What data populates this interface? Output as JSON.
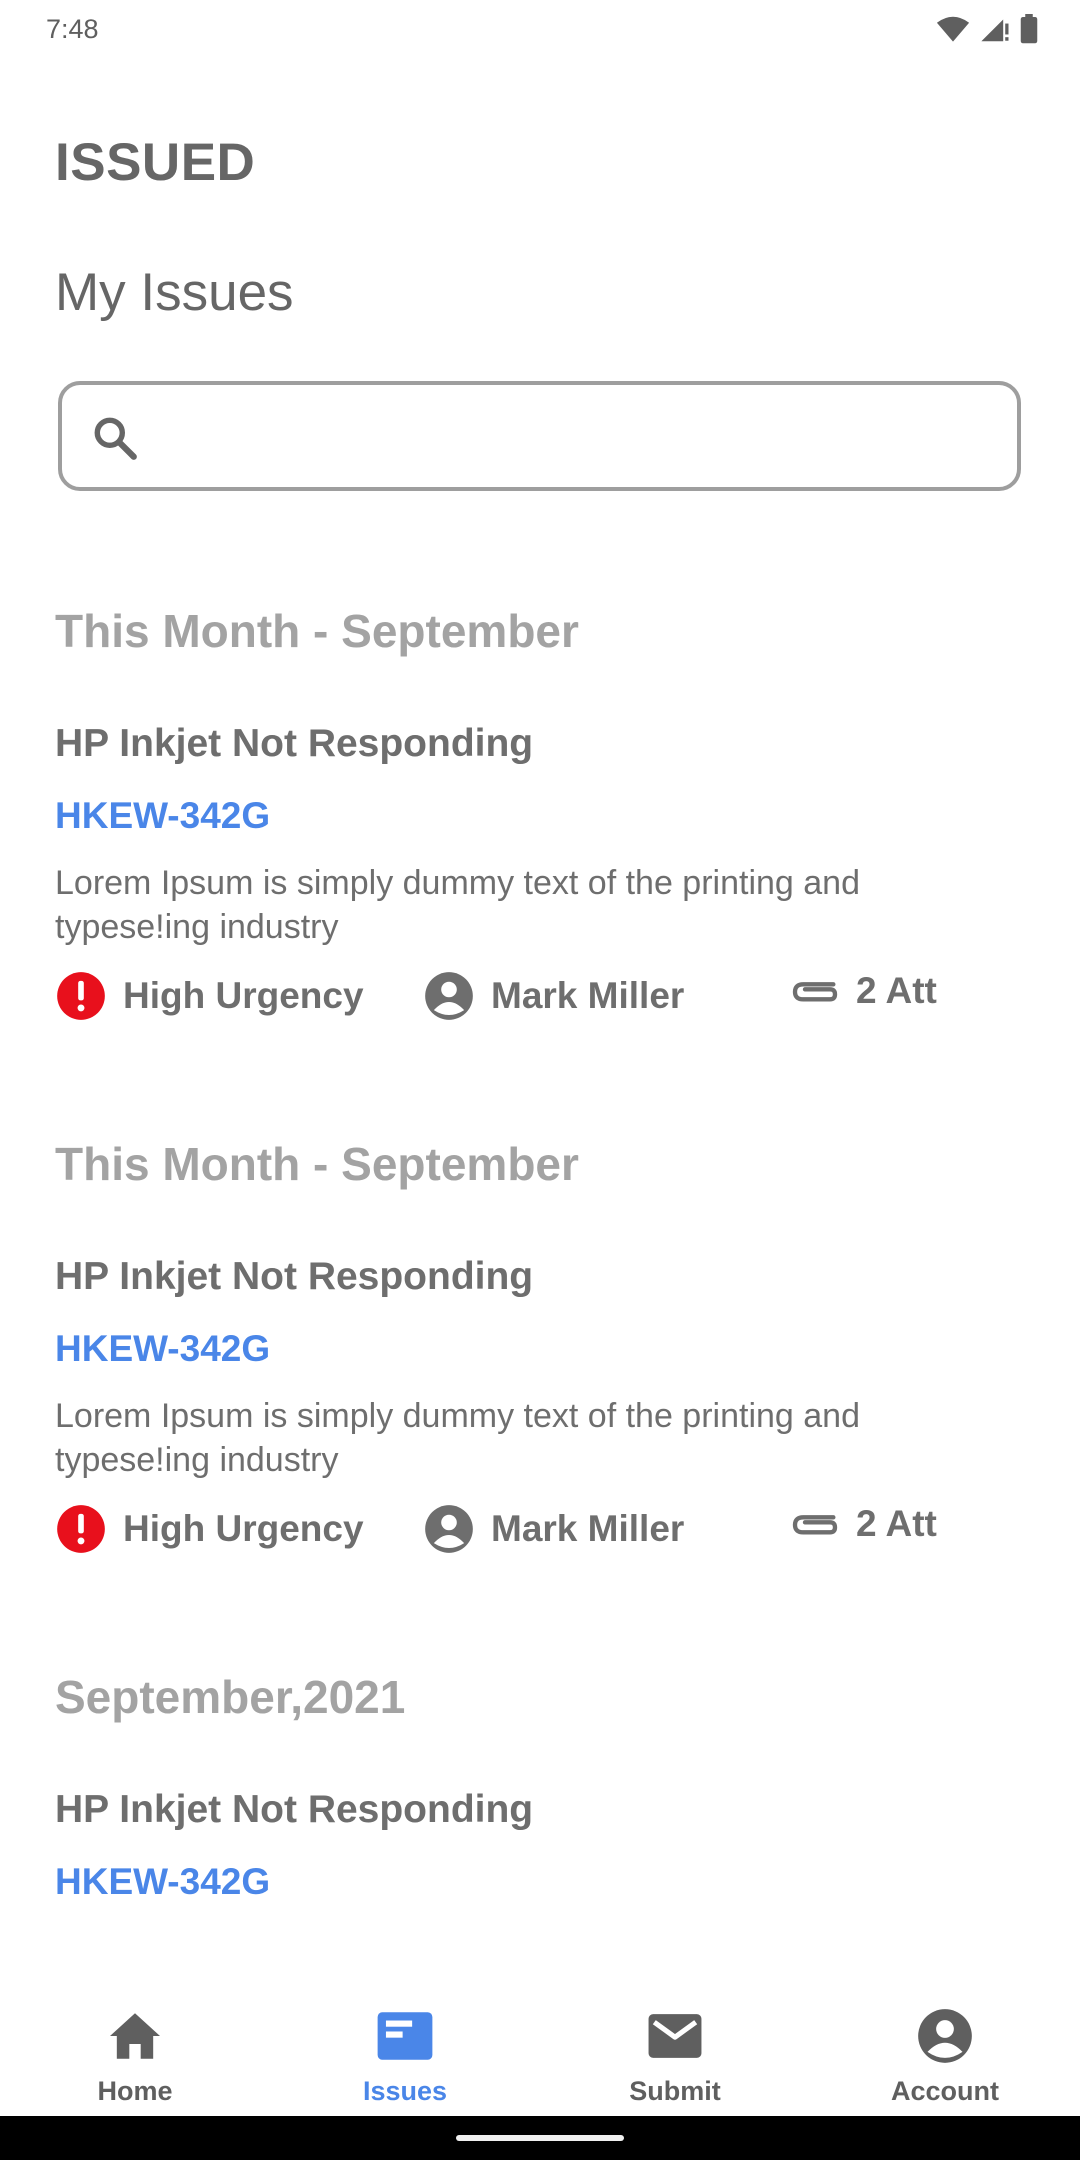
{
  "status_bar": {
    "time": "7:48"
  },
  "app": {
    "title": "ISSUED"
  },
  "page": {
    "title": "My Issues"
  },
  "search": {
    "value": "",
    "placeholder": ""
  },
  "groups": [
    {
      "header": "This Month - September",
      "issues": [
        {
          "title": "HP Inkjet Not Responding",
          "id": "HKEW-342G",
          "desc_line1": "Lorem Ipsum is simply dummy text of the printing and",
          "desc_line2": "typese!ing industry",
          "urgency": "High Urgency",
          "assignee": "Mark Miller",
          "attachments": "2 Att"
        }
      ]
    },
    {
      "header": "This Month - September",
      "issues": [
        {
          "title": "HP Inkjet Not Responding",
          "id": "HKEW-342G",
          "desc_line1": "Lorem Ipsum is simply dummy text of the printing and",
          "desc_line2": "typese!ing industry",
          "urgency": "High Urgency",
          "assignee": "Mark Miller",
          "attachments": "2 Att"
        }
      ]
    },
    {
      "header": "September,2021",
      "issues": [
        {
          "title": "HP Inkjet Not Responding",
          "id": "HKEW-342G"
        }
      ]
    }
  ],
  "nav": {
    "items": [
      {
        "label": "Home",
        "icon": "home-icon"
      },
      {
        "label": "Issues",
        "icon": "issues-icon",
        "active": true
      },
      {
        "label": "Submit",
        "icon": "mail-icon"
      },
      {
        "label": "Account",
        "icon": "account-icon"
      }
    ]
  },
  "colors": {
    "accent": "#4a86e8",
    "urgency": "#e8101c",
    "text": "#6e6e6e",
    "muted": "#a3a3a3"
  }
}
